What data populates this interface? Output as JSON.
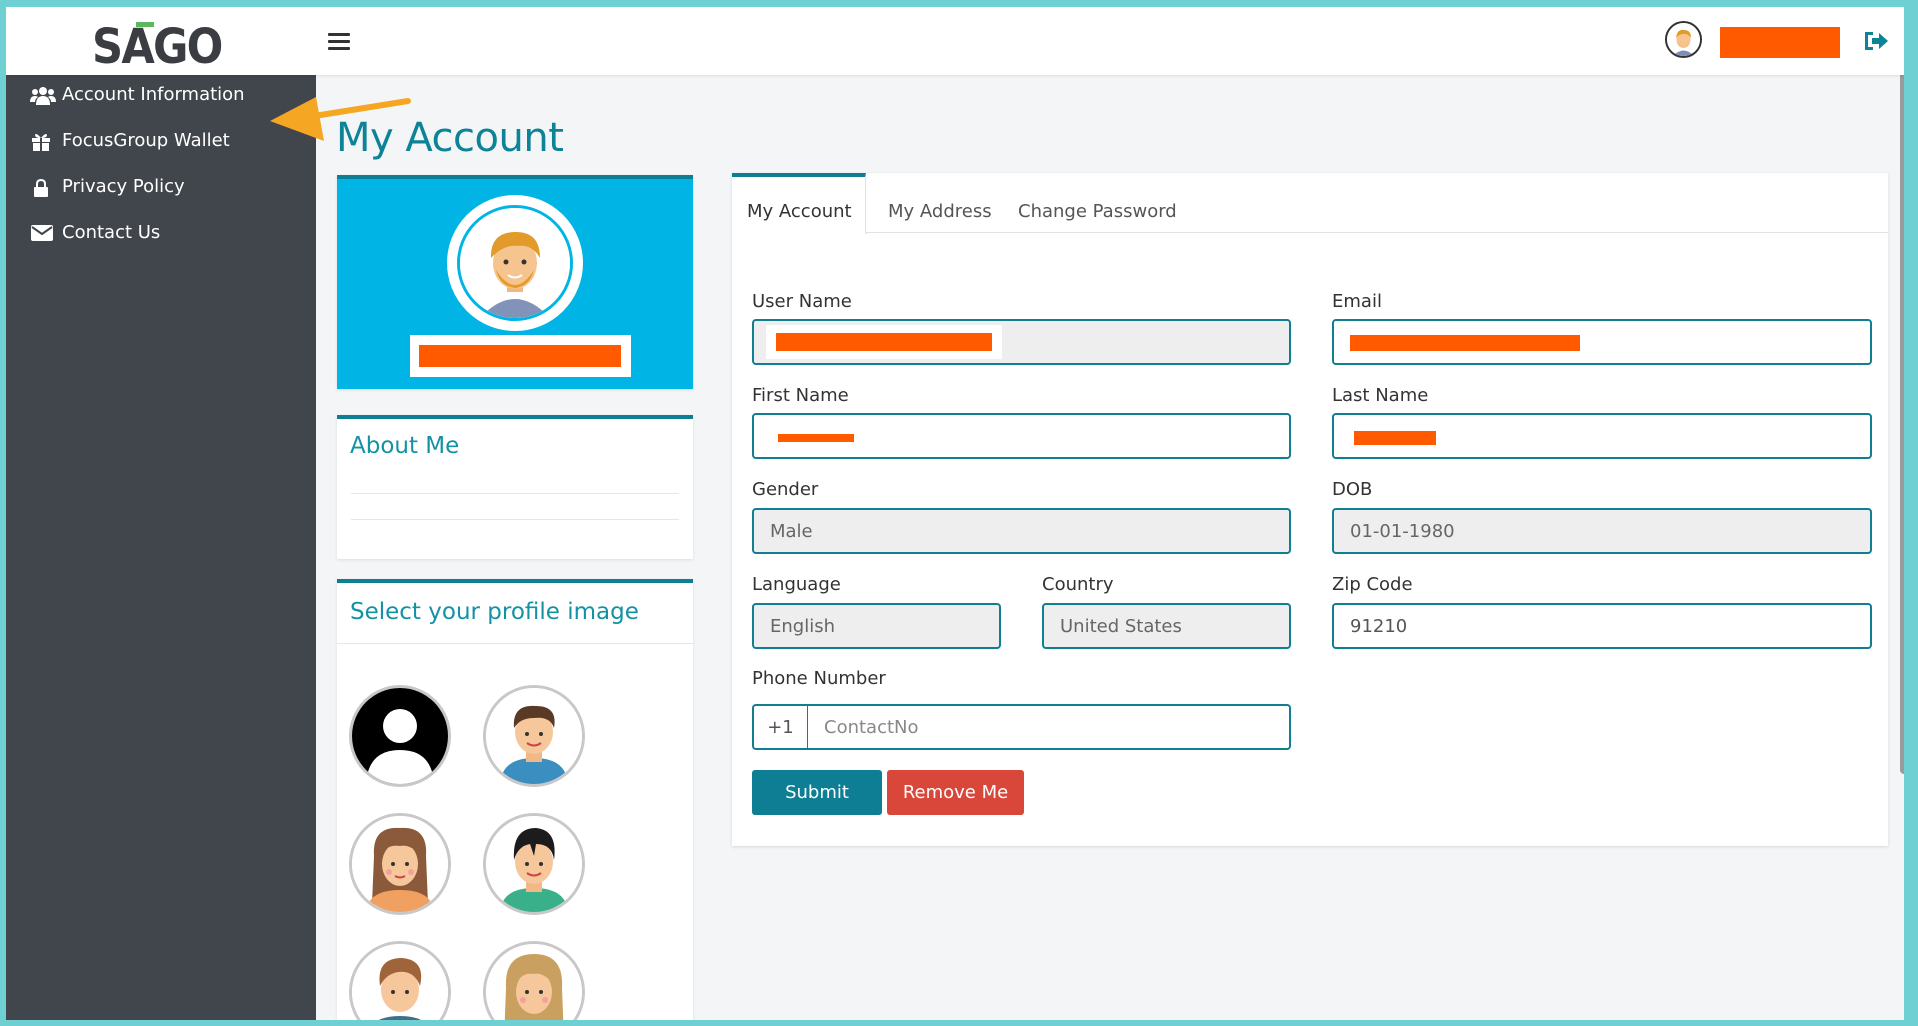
{
  "app": {
    "logo_text": "SAGO",
    "colors": {
      "accent": "#0d7e93",
      "sidebar": "#41464c",
      "redacted": "#ff5a00",
      "danger": "#d9473a",
      "profile_bg": "#00b5e6"
    }
  },
  "header": {
    "menu_icon": "hamburger-icon",
    "logout_icon": "logout-icon"
  },
  "sidebar": {
    "items": [
      {
        "label": "Account Information",
        "icon": "users-icon"
      },
      {
        "label": "FocusGroup Wallet",
        "icon": "gift-icon"
      },
      {
        "label": "Privacy Policy",
        "icon": "lock-icon"
      },
      {
        "label": "Contact Us",
        "icon": "envelope-icon"
      }
    ]
  },
  "main": {
    "title": "My Account",
    "about": {
      "heading": "About Me"
    },
    "select_image": {
      "heading": "Select your profile image"
    },
    "tabs": [
      {
        "label": "My Account",
        "active": true
      },
      {
        "label": "My Address",
        "active": false
      },
      {
        "label": "Change Password",
        "active": false
      }
    ],
    "form": {
      "username_label": "User Name",
      "email_label": "Email",
      "firstname_label": "First Name",
      "lastname_label": "Last Name",
      "gender_label": "Gender",
      "gender_value": "Male",
      "dob_label": "DOB",
      "dob_value": "01-01-1980",
      "language_label": "Language",
      "language_value": "English",
      "country_label": "Country",
      "country_value": "United States",
      "zip_label": "Zip Code",
      "zip_value": "91210",
      "phone_label": "Phone Number",
      "phone_prefix": "+1",
      "phone_placeholder": "ContactNo",
      "submit_label": "Submit",
      "remove_label": "Remove Me"
    }
  }
}
